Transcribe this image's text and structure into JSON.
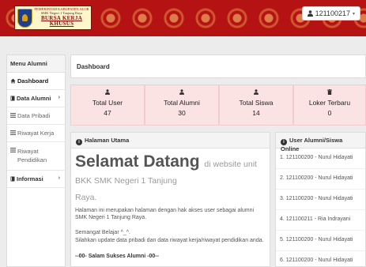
{
  "header": {
    "logo_line1": "PEMERINTAH KABUPATEN ALOR",
    "logo_line2": "SMK Negeri 1 Tanjung Raya",
    "logo_line3": "BURSA KERJA KHUSUS",
    "user_id": "121100217",
    "user_caret": "▾"
  },
  "sidebar": {
    "title": "Menu Alumni",
    "items": [
      {
        "label": "Dashboard",
        "icon": "home-icon"
      },
      {
        "label": "Data Alumni",
        "icon": "book-icon"
      },
      {
        "label": "Data Pribadi",
        "icon": "list-icon"
      },
      {
        "label": "Riwayat Kerja",
        "icon": "list-icon"
      },
      {
        "label": "Riwayat Pendidikan",
        "icon": "list-icon"
      },
      {
        "label": "Informasi",
        "icon": "book-icon"
      }
    ]
  },
  "breadcrumb": "Dashboard",
  "stats": [
    {
      "label": "Total User",
      "value": "47",
      "icon": "user-icon"
    },
    {
      "label": "Total Alumni",
      "value": "30",
      "icon": "user-icon"
    },
    {
      "label": "Total Siswa",
      "value": "14",
      "icon": "user-icon"
    },
    {
      "label": "Loker Terbaru",
      "value": "0",
      "icon": "trash-icon"
    }
  ],
  "main_panel": {
    "title": "Halaman Utama",
    "welcome_big": "Selamat Datang",
    "welcome_small": "di website unit BKK SMK Negeri 1 Tanjung",
    "welcome_cont": "Raya.",
    "para1": "Halaman ini merupakan halaman dengan hak akses user sebagai alumni SMK Negeri 1 Tanjung Raya.",
    "para2a": "Semangat Belajar ^_^.",
    "para2b": "Silahkan update data pribadi dan data riwayat kerja/riwayat pendidikan anda.",
    "motto": "--00- Salam Sukses Alumni -00--"
  },
  "online_panel": {
    "title": "User Alumni/Siswa Online",
    "users": [
      "1. 121100200 - Nurul Hidayati",
      "2. 121100200 - Nurul Hidayati",
      "3. 121100200 - Nurul Hidayati",
      "4. 121100211 - Ria Indrayani",
      "5. 121100200 - Nurul Hidayati",
      "6. 121100200 - Nurul Hidayati"
    ]
  }
}
